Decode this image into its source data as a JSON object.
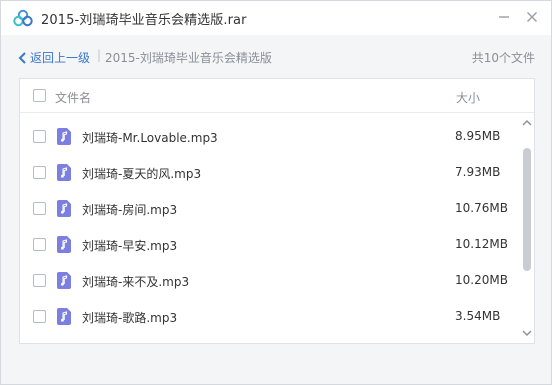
{
  "window": {
    "title": "2015-刘瑞琦毕业音乐会精选版.rar"
  },
  "nav": {
    "back_label": "返回上一级",
    "separator": "|",
    "breadcrumb": "2015-刘瑞琦毕业音乐会精选版",
    "file_count": "共10个文件"
  },
  "table": {
    "col_name": "文件名",
    "col_size": "大小"
  },
  "files": [
    {
      "name": "刘瑞琦-Mr.Lovable.mp3",
      "size": "8.95MB"
    },
    {
      "name": "刘瑞琦-夏天的风.mp3",
      "size": "7.93MB"
    },
    {
      "name": "刘瑞琦-房间.mp3",
      "size": "10.76MB"
    },
    {
      "name": "刘瑞琦-早安.mp3",
      "size": "10.12MB"
    },
    {
      "name": "刘瑞琦-来不及.mp3",
      "size": "10.20MB"
    },
    {
      "name": "刘瑞琦-歌路.mp3",
      "size": "3.54MB"
    }
  ],
  "icons": {
    "app": "cloud-logo-icon",
    "minimize": "minimize-icon",
    "close": "close-icon",
    "back": "chevron-left-icon",
    "file": "music-file-icon"
  },
  "colors": {
    "accent": "#3b77c8",
    "file_icon": "#7b7fe0",
    "logo_blue": "#4a90e2",
    "logo_teal": "#35c3c8"
  }
}
